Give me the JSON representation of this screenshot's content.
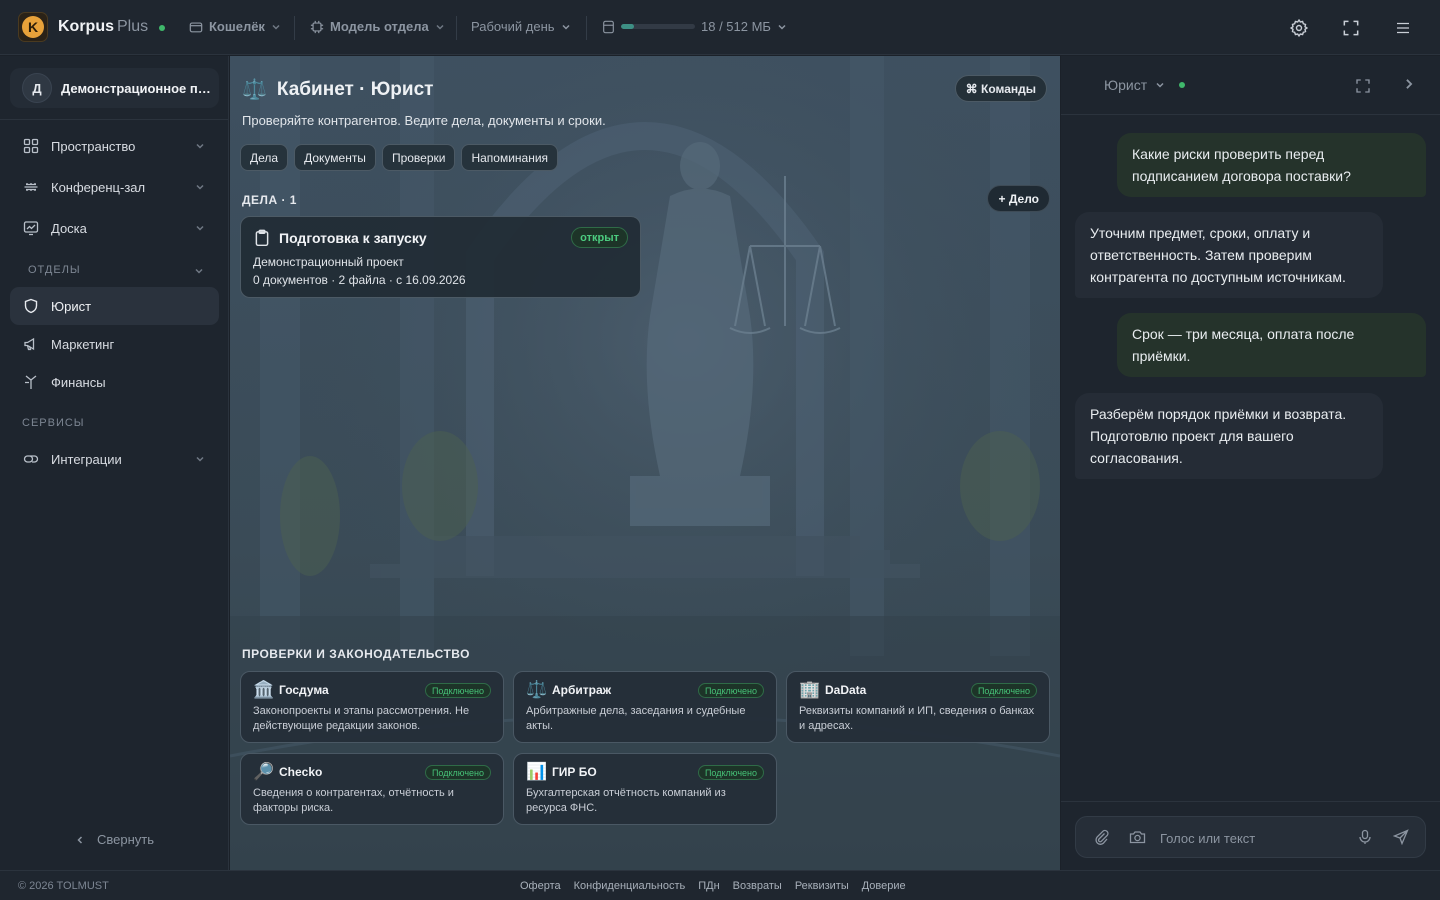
{
  "app": {
    "brand": "Korpus",
    "brand_suffix": "Plus"
  },
  "topbar": {
    "wallet_label": "Кошелёк",
    "model_label": "Модель отдела",
    "mode_label": "Рабочий день",
    "storage_text": "18 / 512 МБ",
    "storage_fill": 0.035
  },
  "sidebar": {
    "workspace_initial": "Д",
    "workspace_name": "Демонстрационное пространство",
    "nav": [
      {
        "label": "Пространство"
      },
      {
        "label": "Конференц-зал"
      },
      {
        "label": "Доска"
      }
    ],
    "departments_label": "ОТДЕЛЫ",
    "departments": [
      {
        "label": "Юрист"
      },
      {
        "label": "Маркетинг"
      },
      {
        "label": "Финансы"
      }
    ],
    "services_label": "СЕРВИСЫ",
    "services": [
      {
        "label": "Интеграции"
      }
    ],
    "collapse_label": "Свернуть"
  },
  "main": {
    "title_icon": "⚖️",
    "title": "Кабинет · Юрист",
    "subtitle": "Проверяйте контрагентов. Ведите дела, документы и сроки.",
    "commands_label": "⌘ Команды",
    "tabs": [
      "Дела",
      "Документы",
      "Проверки",
      "Напоминания"
    ],
    "cases_heading": "ДЕЛА · 1",
    "add_case_label": "+ Дело",
    "case": {
      "title": "Подготовка к запуску",
      "status": "открыт",
      "project": "Демонстрационный проект",
      "meta": "0 документов · 2 файла · с 16.09.2026"
    },
    "checks_heading": "ПРОВЕРКИ И ЗАКОНОДАТЕЛЬСТВО",
    "integrations": [
      {
        "icon": "🏛️",
        "name": "Госдума",
        "status": "Подключено",
        "desc": "Законопроекты и этапы рассмотрения. Не действующие редакции законов."
      },
      {
        "icon": "⚖️",
        "name": "Арбитраж",
        "status": "Подключено",
        "desc": "Арбитражные дела, заседания и судебные акты."
      },
      {
        "icon": "🏢",
        "name": "DaData",
        "status": "Подключено",
        "desc": "Реквизиты компаний и ИП, сведения о банках и адресах."
      },
      {
        "icon": "🔎",
        "name": "Checko",
        "status": "Подключено",
        "desc": "Сведения о контрагентах, отчётность и факторы риска."
      },
      {
        "icon": "📊",
        "name": "ГИР БО",
        "status": "Подключено",
        "desc": "Бухгалтерская отчётность компаний из ресурса ФНС."
      }
    ]
  },
  "chat": {
    "role": "Юрист",
    "messages": [
      {
        "from": "user",
        "text": "Какие риски проверить перед подписанием договора поставки?"
      },
      {
        "from": "bot",
        "text": "Уточним предмет, сроки, оплату и ответственность. Затем проверим контрагента по доступным источникам."
      },
      {
        "from": "user",
        "text": "Срок — три месяца, оплата после приёмки."
      },
      {
        "from": "bot",
        "text": "Разберём порядок приёмки и возврата. Подготовлю проект для вашего согласования."
      }
    ],
    "input_placeholder": "Голос или текст"
  },
  "footer": {
    "copyright": "© 2026 TOLMUST",
    "links": [
      "Оферта",
      "Конфиденциальность",
      "ПДн",
      "Возвраты",
      "Реквизиты",
      "Доверие"
    ]
  },
  "colors": {
    "accent_green": "#3fb86b",
    "brand_orange": "#e8a23a",
    "user_bubble": "#25332b"
  }
}
